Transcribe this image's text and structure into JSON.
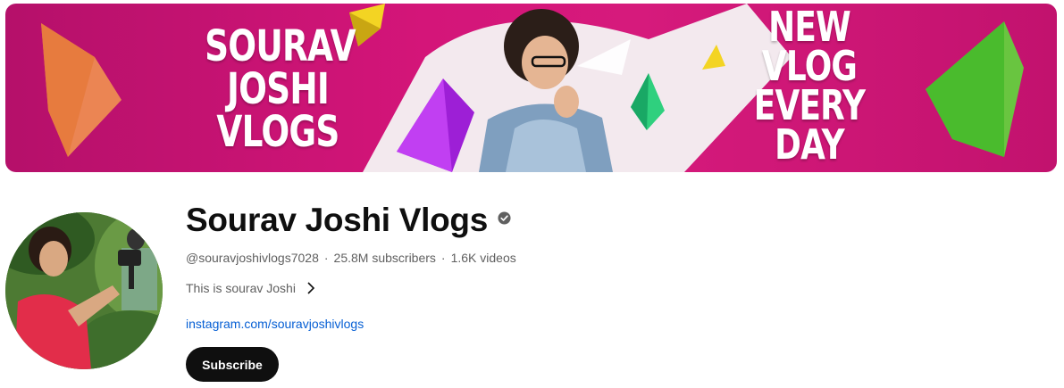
{
  "banner": {
    "title_lines": [
      "SOURAV",
      "JOSHI",
      "VLOGS"
    ],
    "tagline_lines": [
      "NEW",
      "VLOG",
      "EVERY",
      "DAY"
    ],
    "brand_color": "#d41579"
  },
  "channel": {
    "name": "Sourav Joshi Vlogs",
    "verified_icon": "verified-check-icon",
    "handle": "@souravjoshivlogs7028",
    "subscribers": "25.8M subscribers",
    "videos": "1.6K videos",
    "separator": "·",
    "description": "This is sourav Joshi",
    "link": "instagram.com/souravjoshivlogs"
  },
  "actions": {
    "subscribe_label": "Subscribe"
  },
  "colors": {
    "text_primary": "#0f0f0f",
    "text_secondary": "#606060",
    "link": "#065fd4",
    "button_bg": "#0f0f0f"
  }
}
